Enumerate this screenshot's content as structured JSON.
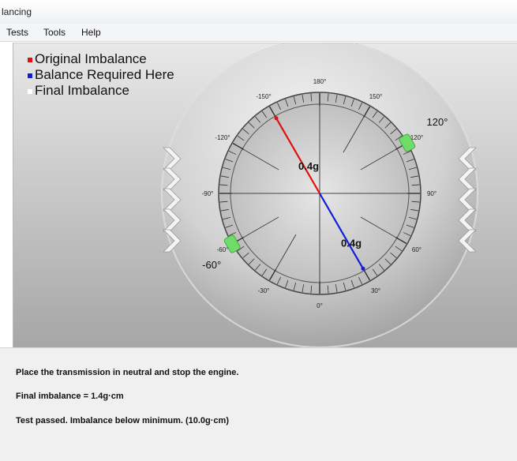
{
  "window": {
    "title": "lancing"
  },
  "menu": {
    "items": [
      "Tests",
      "Tools",
      "Help"
    ]
  },
  "legend": {
    "items": [
      {
        "label": "Original Imbalance",
        "color": "#e01010"
      },
      {
        "label": "Balance Required Here",
        "color": "#1020d8"
      },
      {
        "label": "Final Imbalance",
        "color": "#ffffff"
      }
    ]
  },
  "gauge": {
    "angle_labels": [
      "180°",
      "150°",
      "120°",
      "90°",
      "60°",
      "30°",
      "0°",
      "-30°",
      "-60°",
      "-90°",
      "-120°",
      "-150°"
    ],
    "original_imbalance": {
      "value_label": "0.4g",
      "angle_deg": -150
    },
    "balance_required": {
      "value_label": "0.4g",
      "angle_deg": 30
    },
    "weight_marks": [
      {
        "label": "120°",
        "angle_deg": 120
      },
      {
        "label": "-60°",
        "angle_deg": -60
      }
    ]
  },
  "messages": [
    "Place the transmission in neutral and stop the engine.",
    "Final imbalance = 1.4g·cm",
    "Test passed. Imbalance below minimum. (10.0g·cm)"
  ]
}
